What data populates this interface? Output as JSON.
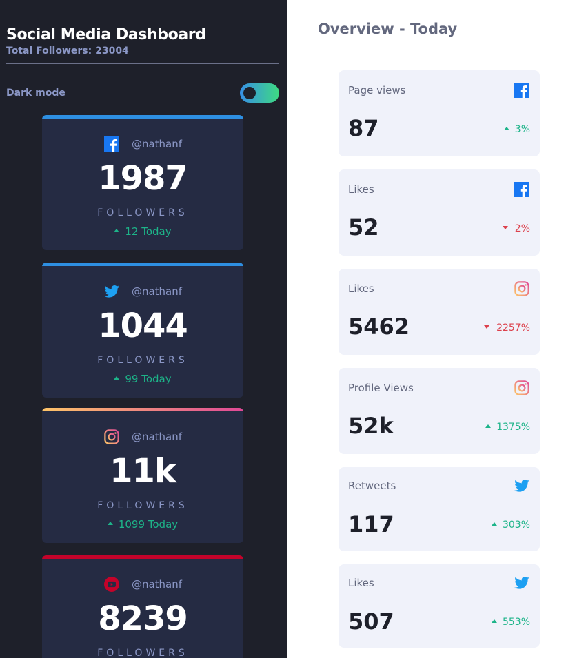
{
  "header": {
    "title": "Social Media Dashboard",
    "total_followers": "Total Followers: 23004",
    "dark_mode_label": "Dark mode",
    "dark_mode_on": true
  },
  "followers": [
    {
      "platform": "facebook",
      "icon": "facebook-icon",
      "handle": "@nathanf",
      "count": "1987",
      "label": "FOLLOWERS",
      "today": "12 Today",
      "trend": "up",
      "accent": "#2e8fe2"
    },
    {
      "platform": "twitter",
      "icon": "twitter-icon",
      "handle": "@nathanf",
      "count": "1044",
      "label": "FOLLOWERS",
      "today": "99 Today",
      "trend": "up",
      "accent": "#2e8fe2"
    },
    {
      "platform": "instagram",
      "icon": "instagram-icon",
      "handle": "@nathanf",
      "count": "11k",
      "label": "FOLLOWERS",
      "today": "1099 Today",
      "trend": "up",
      "accent": "#df4996"
    },
    {
      "platform": "youtube",
      "icon": "youtube-icon",
      "handle": "@nathanf",
      "count": "8239",
      "label": "FOLLOWERS",
      "today": "",
      "trend": "",
      "accent": "#c4032a"
    }
  ],
  "overview": {
    "title": "Overview - Today",
    "cards": [
      {
        "metric": "Page views",
        "icon": "facebook-icon",
        "value": "87",
        "change": "3%",
        "trend": "up"
      },
      {
        "metric": "Likes",
        "icon": "facebook-icon",
        "value": "52",
        "change": "2%",
        "trend": "down"
      },
      {
        "metric": "Likes",
        "icon": "instagram-icon",
        "value": "5462",
        "change": "2257%",
        "trend": "down"
      },
      {
        "metric": "Profile Views",
        "icon": "instagram-icon",
        "value": "52k",
        "change": "1375%",
        "trend": "up"
      },
      {
        "metric": "Retweets",
        "icon": "twitter-icon",
        "value": "117",
        "change": "303%",
        "trend": "up"
      },
      {
        "metric": "Likes",
        "icon": "twitter-icon",
        "value": "507",
        "change": "553%",
        "trend": "up"
      }
    ]
  },
  "colors": {
    "up": "#1db489",
    "down": "#dc414c",
    "facebook": "#1877f2",
    "twitter": "#1da0f2",
    "youtube": "#c4032a",
    "toggle_gradient": [
      "#378fe6",
      "#3eda82"
    ]
  }
}
